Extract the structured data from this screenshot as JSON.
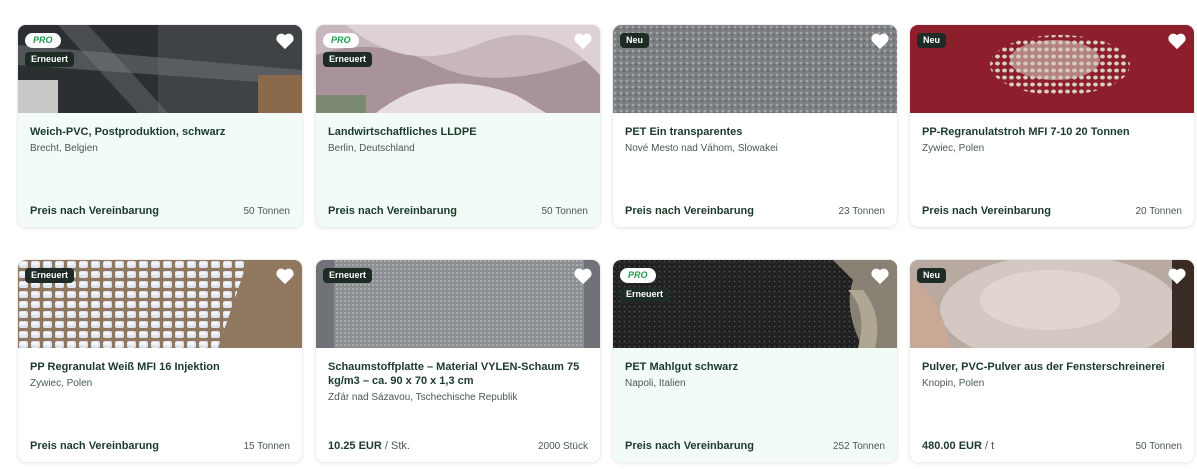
{
  "listings": [
    {
      "pro_label": "PRO",
      "status_label": "Erneuert",
      "title": "Weich-PVC, Postproduktion, schwarz",
      "location": "Brecht, Belgien",
      "price": "Preis nach Vereinbarung",
      "price_unit": "",
      "quantity": "50 Tonnen",
      "image_colors": [
        "#3a3d3f",
        "#6f7578"
      ]
    },
    {
      "pro_label": "PRO",
      "status_label": "Erneuert",
      "title": "Landwirtschaftliches LLDPE",
      "location": "Berlin, Deutschland",
      "price": "Preis nach Vereinbarung",
      "price_unit": "",
      "quantity": "50 Tonnen",
      "image_colors": [
        "#b9a5ad",
        "#d9ccd2"
      ]
    },
    {
      "pro_label": "",
      "status_label": "Neu",
      "title": "PET Ein transparentes",
      "location": "Nové Mesto nad Váhom, Slowakei",
      "price": "Preis nach Vereinbarung",
      "price_unit": "",
      "quantity": "23 Tonnen",
      "image_colors": [
        "#6b6e70",
        "#9a9c9d"
      ]
    },
    {
      "pro_label": "",
      "status_label": "Neu",
      "title": "PP-Regranulatstroh MFI 7-10 20 Tonnen",
      "location": "Żywiec, Polen",
      "price": "Preis nach Vereinbarung",
      "price_unit": "",
      "quantity": "20 Tonnen",
      "image_colors": [
        "#8a1f2a",
        "#d8cfc2"
      ]
    },
    {
      "pro_label": "",
      "status_label": "Erneuert",
      "title": "PP Regranulat Weiß MFI 16 Injektion",
      "location": "Żywiec, Polen",
      "price": "Preis nach Vereinbarung",
      "price_unit": "",
      "quantity": "15 Tonnen",
      "image_colors": [
        "#8a6a4c",
        "#dfe6ef"
      ]
    },
    {
      "pro_label": "",
      "status_label": "Erneuert",
      "title": "Schaumstoffplatte – Material VYLEN-Schaum 75 kg/m3 – ca. 90 x 70 x 1,3 cm",
      "location": "Žďár nad Sázavou, Tschechische Republik",
      "price": "10.25 EUR",
      "price_unit": " / Stk.",
      "quantity": "2000 Stück",
      "image_colors": [
        "#7d8084",
        "#a9abae"
      ]
    },
    {
      "pro_label": "PRO",
      "status_label": "Erneuert",
      "title": "PET Mahlgut schwarz",
      "location": "Napoli, Italien",
      "price": "Preis nach Vereinbarung",
      "price_unit": "",
      "quantity": "252 Tonnen",
      "image_colors": [
        "#262626",
        "#8a8175"
      ]
    },
    {
      "pro_label": "",
      "status_label": "Neu",
      "title": "Pulver, PVC-Pulver aus der Fensterschreinerei",
      "location": "Knopin, Polen",
      "price": "480.00 EUR",
      "price_unit": " / t",
      "quantity": "50 Tonnen",
      "image_colors": [
        "#b3a59c",
        "#d8cdc6"
      ]
    }
  ]
}
